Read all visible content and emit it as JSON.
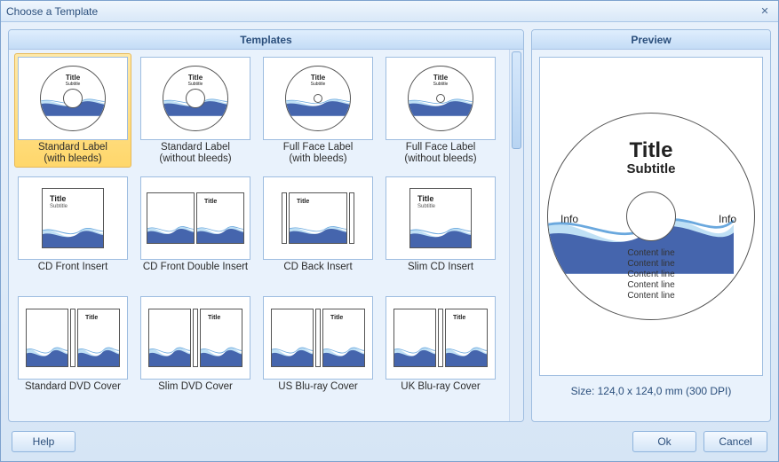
{
  "window": {
    "title": "Choose a Template"
  },
  "panels": {
    "templates": "Templates",
    "preview": "Preview"
  },
  "templates": [
    {
      "id": "std-label-bleed",
      "label": "Standard Label\n(with bleeds)",
      "kind": "cd-small",
      "selected": true
    },
    {
      "id": "std-label-nobleed",
      "label": "Standard Label\n(without bleeds)",
      "kind": "cd-small",
      "selected": false
    },
    {
      "id": "full-face-bleed",
      "label": "Full Face Label\n(with bleeds)",
      "kind": "cd-full",
      "selected": false
    },
    {
      "id": "full-face-nobleed",
      "label": "Full Face Label\n(without bleeds)",
      "kind": "cd-full",
      "selected": false
    },
    {
      "id": "cd-front-insert",
      "label": "CD Front Insert",
      "kind": "insert1",
      "selected": false
    },
    {
      "id": "cd-front-double",
      "label": "CD Front Double Insert",
      "kind": "insert2",
      "selected": false
    },
    {
      "id": "cd-back-insert",
      "label": "CD Back Insert",
      "kind": "insert-sp",
      "selected": false
    },
    {
      "id": "slim-cd-insert",
      "label": "Slim CD Insert",
      "kind": "insert1",
      "selected": false
    },
    {
      "id": "std-dvd-cover",
      "label": "Standard DVD Cover",
      "kind": "dvd",
      "selected": false
    },
    {
      "id": "slim-dvd-cover",
      "label": "Slim DVD Cover",
      "kind": "dvd",
      "selected": false
    },
    {
      "id": "us-bluray-cover",
      "label": "US Blu-ray Cover",
      "kind": "dvd",
      "selected": false
    },
    {
      "id": "uk-bluray-cover",
      "label": "UK Blu-ray Cover",
      "kind": "dvd",
      "selected": false
    }
  ],
  "preview": {
    "title": "Title",
    "subtitle": "Subtitle",
    "info_left": "Info",
    "info_right": "Info",
    "content_lines": [
      "Content line",
      "Content line",
      "Content line",
      "Content line",
      "Content line"
    ],
    "size_text": "Size: 124,0 x 124,0 mm (300 DPI)"
  },
  "buttons": {
    "help": "Help",
    "ok": "Ok",
    "cancel": "Cancel"
  }
}
